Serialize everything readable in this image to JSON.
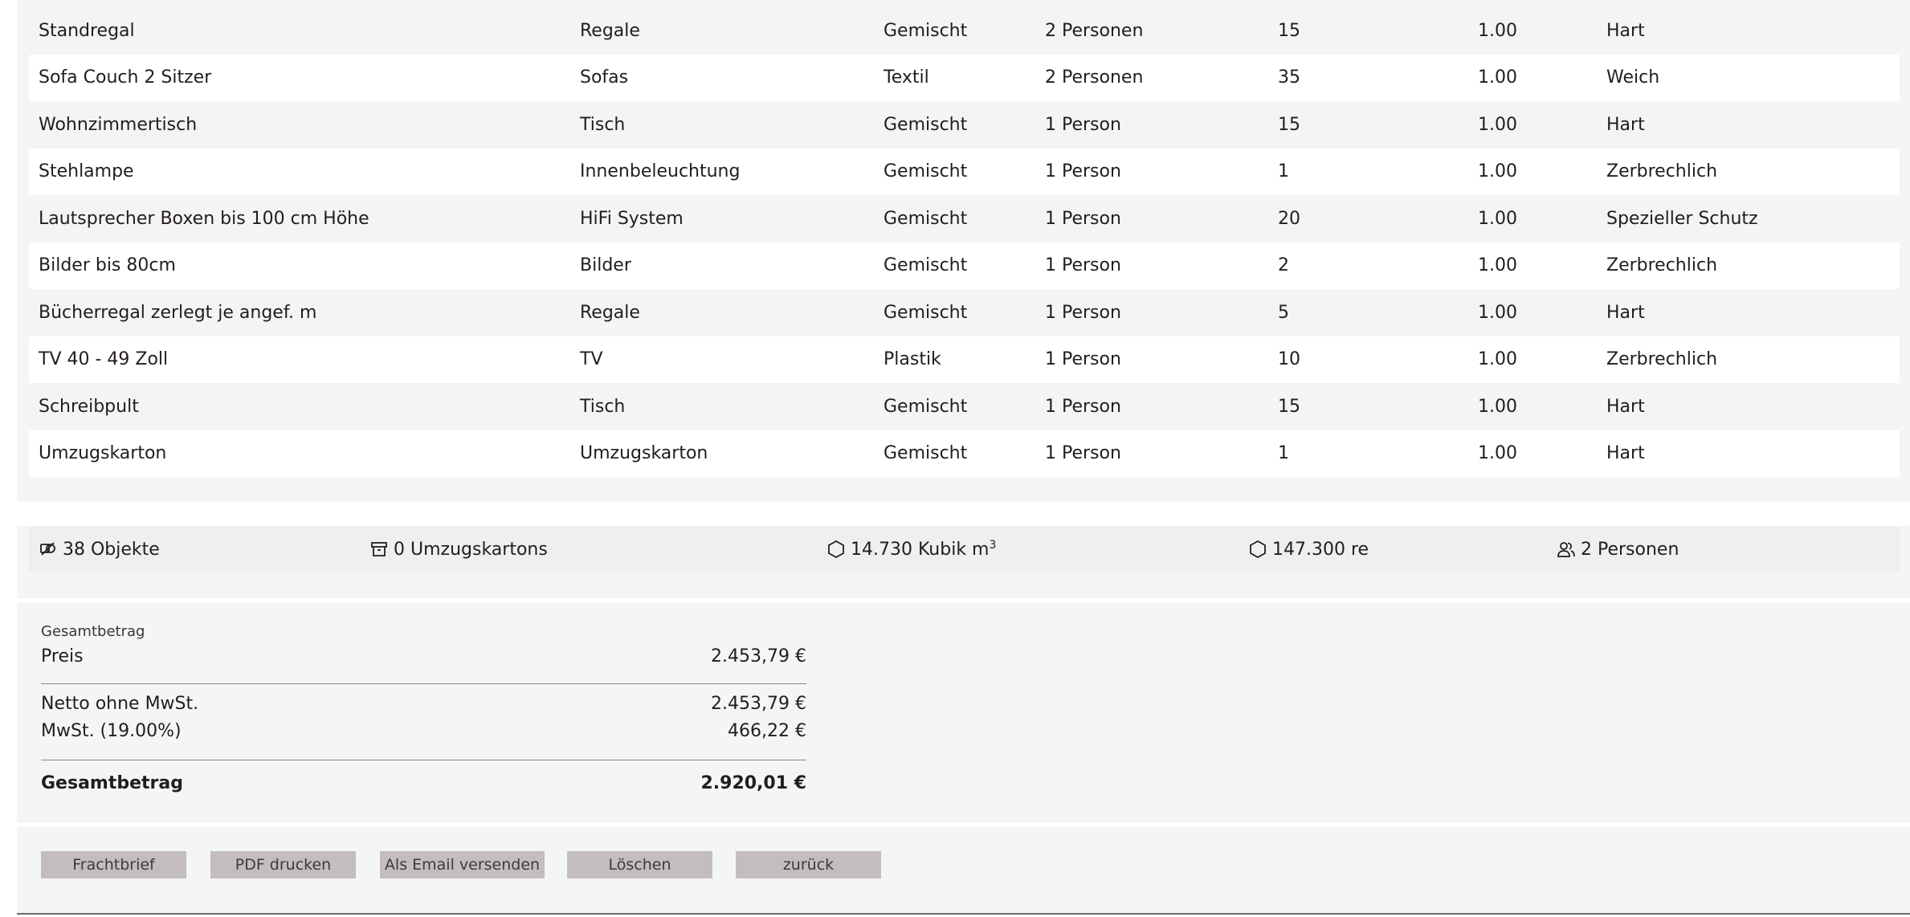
{
  "items": [
    [
      "Standregal",
      "Regale",
      "Gemischt",
      "2 Personen",
      "15",
      "1.00",
      "Hart"
    ],
    [
      "Sofa Couch 2 Sitzer",
      "Sofas",
      "Textil",
      "2 Personen",
      "35",
      "1.00",
      "Weich"
    ],
    [
      "Wohnzimmertisch",
      "Tisch",
      "Gemischt",
      "1 Person",
      "15",
      "1.00",
      "Hart"
    ],
    [
      "Stehlampe",
      "Innenbeleuchtung",
      "Gemischt",
      "1 Person",
      "1",
      "1.00",
      "Zerbrechlich"
    ],
    [
      "Lautsprecher Boxen bis 100 cm Höhe",
      "HiFi System",
      "Gemischt",
      "1 Person",
      "20",
      "1.00",
      "Spezieller Schutz"
    ],
    [
      "Bilder bis 80cm",
      "Bilder",
      "Gemischt",
      "1 Person",
      "2",
      "1.00",
      "Zerbrechlich"
    ],
    [
      "Bücherregal zerlegt je angef. m",
      "Regale",
      "Gemischt",
      "1 Person",
      "5",
      "1.00",
      "Hart"
    ],
    [
      "TV 40 - 49 Zoll",
      "TV",
      "Plastik",
      "1 Person",
      "10",
      "1.00",
      "Zerbrechlich"
    ],
    [
      "Schreibpult",
      "Tisch",
      "Gemischt",
      "1 Person",
      "15",
      "1.00",
      "Hart"
    ],
    [
      "Umzugskarton",
      "Umzugskarton",
      "Gemischt",
      "1 Person",
      "1",
      "1.00",
      "Hart"
    ]
  ],
  "summary": {
    "objects": "38 Objekte",
    "boxes": "0 Umzugskartons",
    "volume": "14.730 Kubik m",
    "volume_sup": "3",
    "re": "147.300 re",
    "persons": "2 Personen"
  },
  "totals": {
    "caption": "Gesamtbetrag",
    "price_label": "Preis",
    "price_value": "2.453,79 €",
    "net_label": "Netto ohne MwSt.",
    "net_value": "2.453,79 €",
    "vat_label": "MwSt. (19.00%)",
    "vat_value": "466,22 €",
    "grand_label": "Gesamtbetrag",
    "grand_value": "2.920,01 €"
  },
  "buttons": {
    "waybill": "Frachtbrief",
    "pdf": "PDF drucken",
    "email": "Als Email versenden",
    "delete": "Löschen",
    "back": "zurück"
  },
  "icons": {
    "objects": "objects-icon",
    "boxes": "archive-box-icon",
    "volume": "hexagon-icon",
    "re": "hexagon-icon",
    "persons": "users-icon"
  },
  "colors": {
    "panel_bg": "#f4f6f5",
    "button_bg": "#c3bdbf",
    "text": "#231c1f"
  }
}
